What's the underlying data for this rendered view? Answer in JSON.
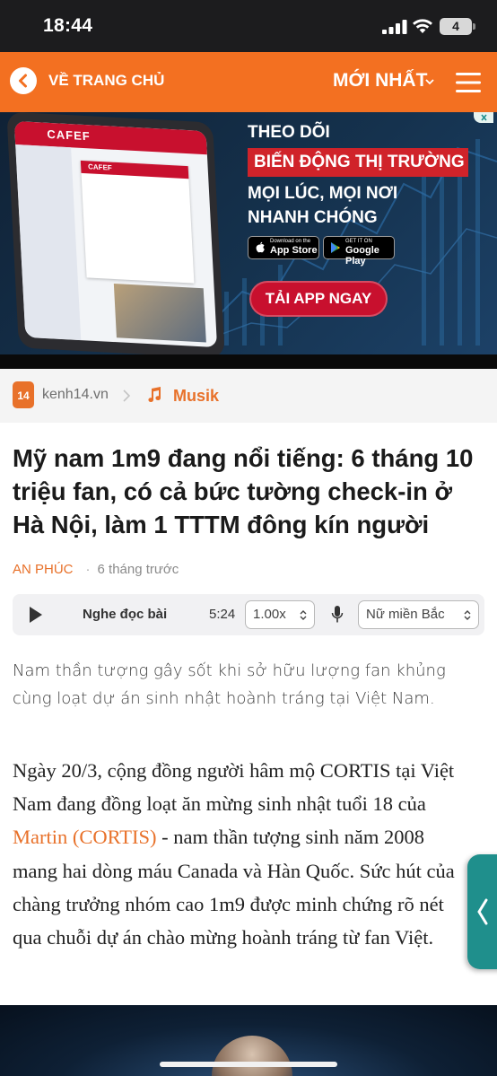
{
  "status_bar": {
    "time": "18:44",
    "battery": "4"
  },
  "nav": {
    "back_label": "VỀ TRANG CHỦ",
    "latest_label": "MỚI NHẤT",
    "accent_color": "#f37021"
  },
  "ad": {
    "phone_brand": "CAFEF",
    "card_brand": "CAFEF",
    "line1": "THEO DÕI",
    "line2": "BIẾN ĐỘNG THỊ TRƯỜNG",
    "line3": "MỌI LÚC, MỌI NƠI",
    "line4": "NHANH CHÓNG",
    "appstore_small": "Download on the",
    "appstore_big": "App Store",
    "googleplay_small": "GET IT ON",
    "googleplay_big": "Google Play",
    "cta": "TẢI APP NGAY"
  },
  "source": {
    "logo_text": "14",
    "domain": "kenh14.vn",
    "category": "Musik"
  },
  "article": {
    "headline": "Mỹ nam 1m9 đang nổi tiếng: 6 tháng 10 triệu fan, có cả bức tường check-in ở Hà Nội, làm 1 TTTM đông kín người",
    "author": "AN PHÚC",
    "time_ago": "6 tháng trước",
    "sapo": "Nam thần tượng gây sốt khi sở hữu lượng fan khủng cùng loạt dự án sinh nhật hoành tráng tại Việt Nam.",
    "body_before_link": "Ngày 20/3, cộng đồng người hâm mộ CORTIS tại Việt Nam đang đồng loạt ăn mừng sinh nhật tuổi 18 của ",
    "body_link": "Martin (CORTIS)",
    "body_after_link": " - nam thần tượng sinh năm 2008 mang hai dòng máu Canada và Hàn Quốc. Sức hút của chàng trưởng nhóm cao 1m9 được minh chứng rõ nét qua chuỗi dự án chào mừng hoành tráng từ fan Việt."
  },
  "audio": {
    "listen_label": "Nghe đọc bài",
    "duration": "5:24",
    "speed": "1.00x",
    "voice": "Nữ miền Bắc"
  }
}
